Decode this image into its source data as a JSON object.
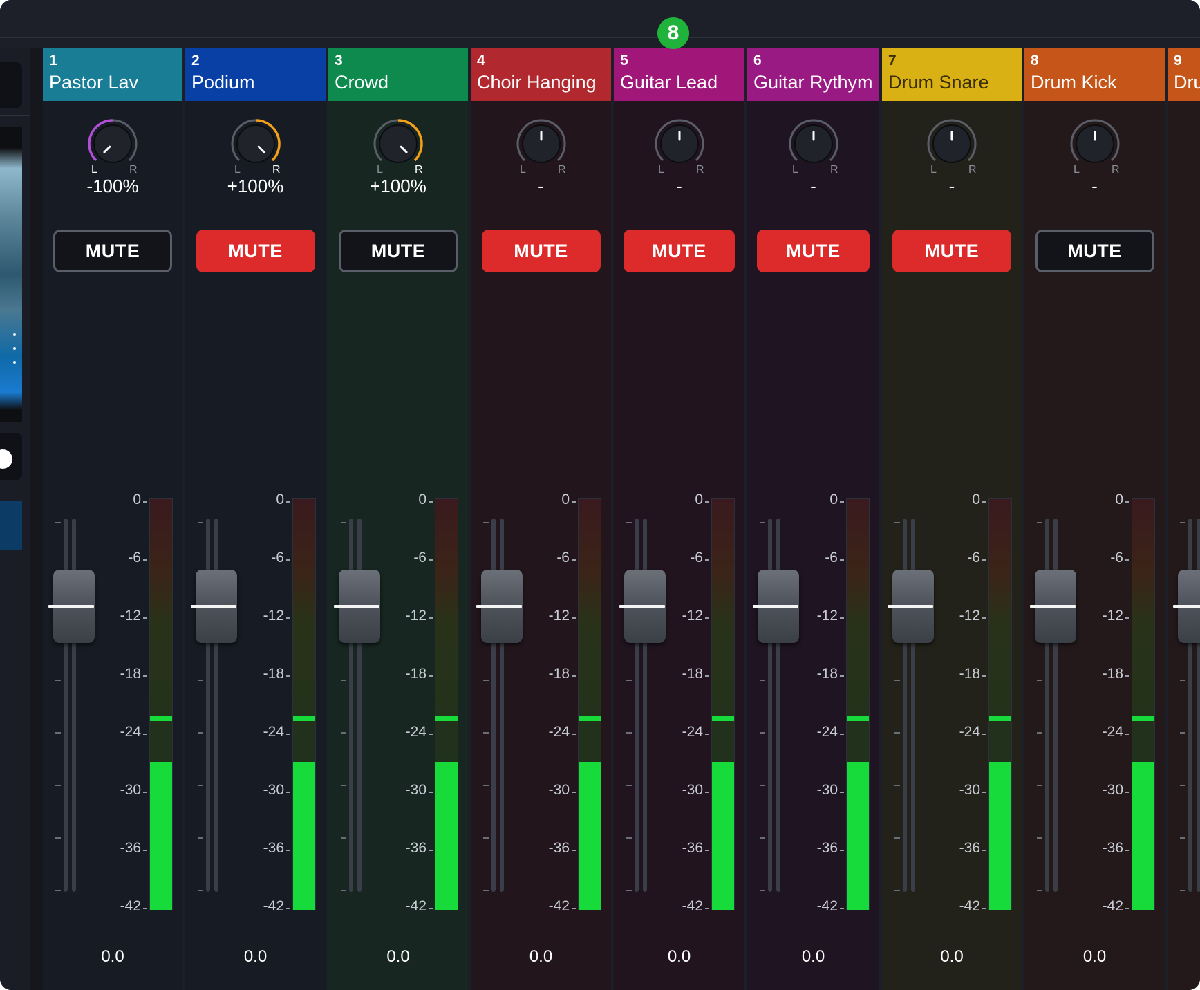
{
  "marker": "8",
  "scale": [
    "0",
    "-6",
    "-12",
    "-18",
    "-24",
    "-30",
    "-36",
    "-42"
  ],
  "channels": [
    {
      "num": "1",
      "name": "Pastor Lav",
      "color": "#187d95",
      "body": "#161b24",
      "pan": "-100%",
      "pan_frac": -1.0,
      "pan_arc": "#b04fd6",
      "mute": "MUTE",
      "muted": false,
      "level_frac": 0.36,
      "peak_frac": 0.46,
      "gain": "0.0"
    },
    {
      "num": "2",
      "name": "Podium",
      "color": "#0840a6",
      "body": "#161b24",
      "pan": "+100%",
      "pan_frac": 1.0,
      "pan_arc": "#f4a019",
      "mute": "MUTE",
      "muted": true,
      "level_frac": 0.36,
      "peak_frac": 0.46,
      "gain": "0.0"
    },
    {
      "num": "3",
      "name": "Crowd",
      "color": "#0f8a4f",
      "body": "#172620",
      "pan": "+100%",
      "pan_frac": 1.0,
      "pan_arc": "#f4a019",
      "mute": "MUTE",
      "muted": false,
      "level_frac": 0.36,
      "peak_frac": 0.46,
      "gain": "0.0"
    },
    {
      "num": "4",
      "name": "Choir Hanging",
      "color": "#b2282f",
      "body": "#22161c",
      "pan": "-",
      "pan_frac": 0,
      "pan_arc": "",
      "mute": "MUTE",
      "muted": true,
      "level_frac": 0.36,
      "peak_frac": 0.46,
      "gain": "0.0"
    },
    {
      "num": "5",
      "name": "Guitar Lead",
      "color": "#a01679",
      "body": "#21141f",
      "pan": "-",
      "pan_frac": 0,
      "pan_arc": "",
      "mute": "MUTE",
      "muted": true,
      "level_frac": 0.36,
      "peak_frac": 0.46,
      "gain": "0.0"
    },
    {
      "num": "6",
      "name": "Guitar Rythym",
      "color": "#9a1a84",
      "body": "#1f1422",
      "pan": "-",
      "pan_frac": 0,
      "pan_arc": "",
      "mute": "MUTE",
      "muted": true,
      "level_frac": 0.36,
      "peak_frac": 0.46,
      "gain": "0.0"
    },
    {
      "num": "7",
      "name": "Drum Snare",
      "color": "#d9b114",
      "body": "#23221a",
      "pan": "-",
      "pan_frac": 0,
      "pan_arc": "",
      "mute": "MUTE",
      "muted": true,
      "level_frac": 0.36,
      "peak_frac": 0.46,
      "gain": "0.0"
    },
    {
      "num": "8",
      "name": "Drum Kick",
      "color": "#c55518",
      "body": "#23191b",
      "pan": "-",
      "pan_frac": 0,
      "pan_arc": "",
      "mute": "MUTE",
      "muted": false,
      "level_frac": 0.36,
      "peak_frac": 0.46,
      "gain": "0.0"
    },
    {
      "num": "9",
      "name": "Dru",
      "color": "#c55518",
      "body": "#23191b",
      "pan": "",
      "pan_frac": 0,
      "pan_arc": "",
      "mute": "",
      "muted": false,
      "level_frac": 0.36,
      "peak_frac": 0.46,
      "gain": ""
    }
  ]
}
